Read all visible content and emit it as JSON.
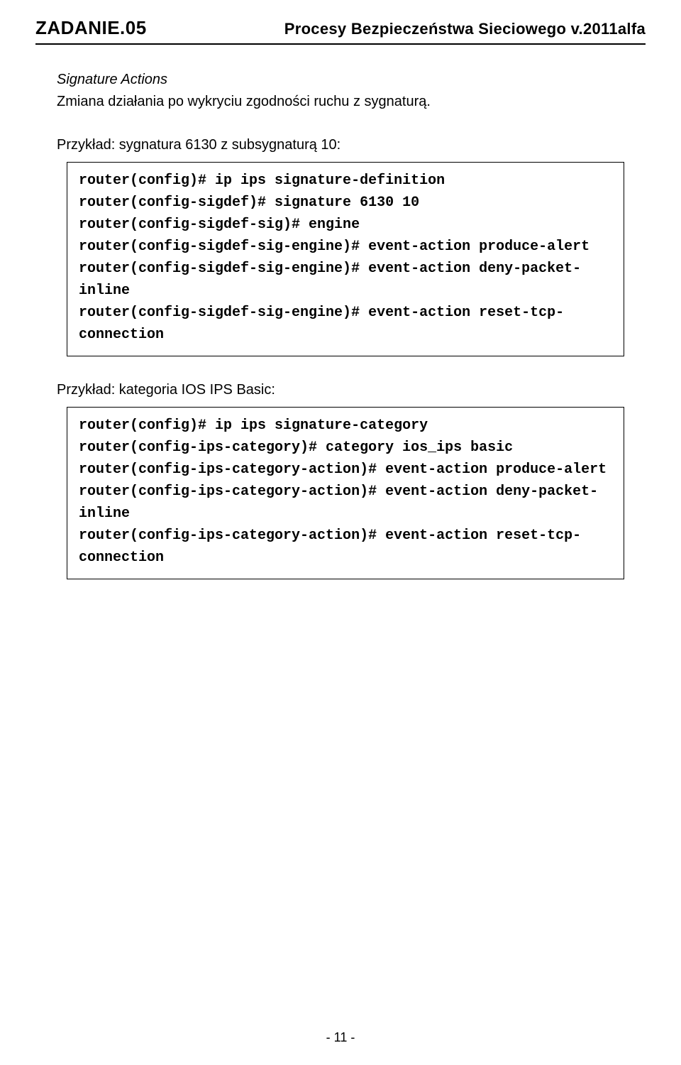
{
  "header": {
    "left": "ZADANIE.05",
    "right": "Procesy Bezpieczeństwa Sieciowego v.2011alfa"
  },
  "intro": {
    "title": "Signature Actions",
    "line": "Zmiana działania po wykryciu zgodności ruchu z sygnaturą."
  },
  "example1": {
    "heading": "Przykład: sygnatura 6130 z subsygnaturą 10:",
    "code": [
      "router(config)# ip ips signature-definition",
      "router(config-sigdef)# signature 6130 10",
      "router(config-sigdef-sig)# engine",
      "router(config-sigdef-sig-engine)# event-action produce-alert",
      "router(config-sigdef-sig-engine)# event-action deny-packet-inline",
      "router(config-sigdef-sig-engine)# event-action reset-tcp-connection"
    ]
  },
  "example2": {
    "heading": "Przykład: kategoria IOS IPS Basic:",
    "code": [
      "router(config)# ip ips signature-category",
      "router(config-ips-category)# category ios_ips basic",
      "router(config-ips-category-action)# event-action produce-alert",
      "router(config-ips-category-action)# event-action deny-packet-inline",
      "router(config-ips-category-action)# event-action reset-tcp-connection"
    ]
  },
  "footer": {
    "page": "- 11 -"
  }
}
